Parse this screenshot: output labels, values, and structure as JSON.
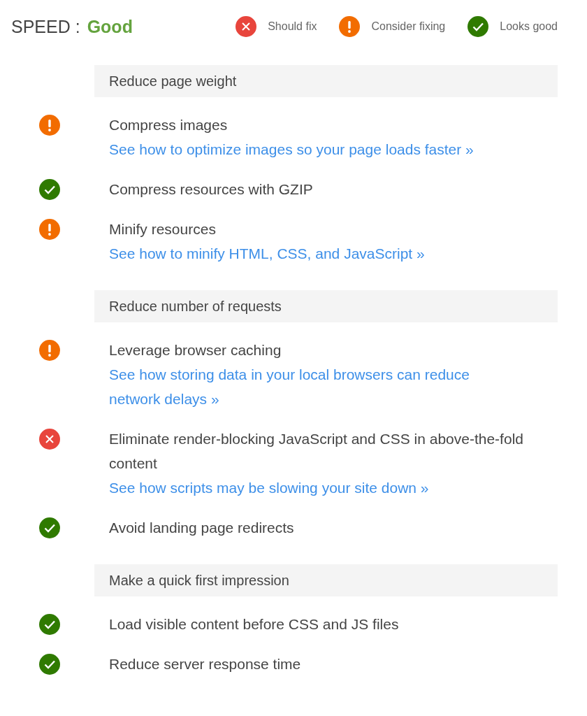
{
  "score": {
    "label": "SPEED :",
    "value": "Good"
  },
  "legend": [
    {
      "kind": "fix",
      "label": "Should fix"
    },
    {
      "kind": "consider",
      "label": "Consider fixing"
    },
    {
      "kind": "good",
      "label": "Looks good"
    }
  ],
  "sections": [
    {
      "title": "Reduce page weight",
      "items": [
        {
          "kind": "consider",
          "title": "Compress images",
          "link": "See how to optimize images so your page loads faster »"
        },
        {
          "kind": "good",
          "title": "Compress resources with GZIP"
        },
        {
          "kind": "consider",
          "title": "Minify resources",
          "link": "See how to minify HTML, CSS, and JavaScript »"
        }
      ]
    },
    {
      "title": "Reduce number of requests",
      "items": [
        {
          "kind": "consider",
          "title": "Leverage browser caching",
          "link": "See how storing data in your local browsers can reduce network delays »"
        },
        {
          "kind": "fix",
          "title": "Eliminate render-blocking JavaScript and CSS in above-the-fold content",
          "link": "See how scripts may be slowing your site down »"
        },
        {
          "kind": "good",
          "title": "Avoid landing page redirects"
        }
      ]
    },
    {
      "title": "Make a quick first impression",
      "items": [
        {
          "kind": "good",
          "title": "Load visible content before CSS and JS files"
        },
        {
          "kind": "good",
          "title": "Reduce server response time"
        }
      ]
    }
  ]
}
